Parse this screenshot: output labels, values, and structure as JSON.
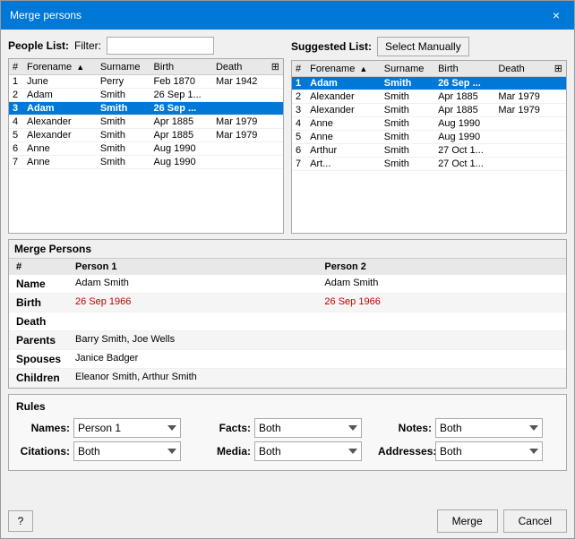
{
  "dialog": {
    "title": "Merge persons",
    "close_label": "×"
  },
  "people_list": {
    "label": "People List:",
    "filter_label": "Filter:",
    "filter_placeholder": "",
    "columns": [
      "#",
      "Forename",
      "Surname",
      "Birth",
      "Death"
    ],
    "rows": [
      {
        "forename": "June",
        "surname": "Perry",
        "birth": "Feb 1870",
        "death": "Mar 1942",
        "selected": false
      },
      {
        "forename": "Adam",
        "surname": "Smith",
        "birth": "26 Sep 1...",
        "death": "",
        "selected": false
      },
      {
        "forename": "Adam",
        "surname": "Smith",
        "birth": "26 Sep ...",
        "death": "",
        "selected": true
      },
      {
        "forename": "Alexander",
        "surname": "Smith",
        "birth": "Apr 1885",
        "death": "Mar 1979",
        "selected": false
      },
      {
        "forename": "Alexander",
        "surname": "Smith",
        "birth": "Apr 1885",
        "death": "Mar 1979",
        "selected": false
      },
      {
        "forename": "Anne",
        "surname": "Smith",
        "birth": "Aug 1990",
        "death": "",
        "selected": false
      },
      {
        "forename": "Anne",
        "surname": "Smith",
        "birth": "Aug 1990",
        "death": "",
        "selected": false
      }
    ]
  },
  "suggested_list": {
    "label": "Suggested List:",
    "select_manually_label": "Select Manually",
    "columns": [
      "#",
      "Forename",
      "Surname",
      "Birth",
      "Death"
    ],
    "rows": [
      {
        "forename": "Adam",
        "surname": "Smith",
        "birth": "26 Sep ...",
        "death": "",
        "selected": true
      },
      {
        "forename": "Alexander",
        "surname": "Smith",
        "birth": "Apr 1885",
        "death": "Mar 1979",
        "selected": false
      },
      {
        "forename": "Alexander",
        "surname": "Smith",
        "birth": "Apr 1885",
        "death": "Mar 1979",
        "selected": false
      },
      {
        "forename": "Anne",
        "surname": "Smith",
        "birth": "Aug 1990",
        "death": "",
        "selected": false
      },
      {
        "forename": "Anne",
        "surname": "Smith",
        "birth": "Aug 1990",
        "death": "",
        "selected": false
      },
      {
        "forename": "Arthur",
        "surname": "Smith",
        "birth": "27 Oct 1...",
        "death": "",
        "selected": false
      },
      {
        "forename": "Art...",
        "surname": "Smith",
        "birth": "27 Oct 1...",
        "death": "",
        "selected": false
      }
    ]
  },
  "merge_persons": {
    "section_title": "Merge Persons",
    "col_hash": "#",
    "col_person1": "Person 1",
    "col_person2": "Person 2",
    "fields": [
      {
        "label": "Name",
        "person1": "Adam Smith",
        "person2": "Adam Smith",
        "p1_highlight": false,
        "p2_highlight": false
      },
      {
        "label": "Birth",
        "person1": "26 Sep 1966",
        "person2": "26 Sep 1966",
        "p1_highlight": true,
        "p2_highlight": true
      },
      {
        "label": "Death",
        "person1": "",
        "person2": "",
        "p1_highlight": false,
        "p2_highlight": false
      },
      {
        "label": "Parents",
        "person1": "Barry Smith, Joe Wells",
        "person2": "",
        "p1_highlight": false,
        "p2_highlight": false
      },
      {
        "label": "Spouses",
        "person1": "Janice Badger",
        "person2": "",
        "p1_highlight": false,
        "p2_highlight": false
      },
      {
        "label": "Children",
        "person1": "Eleanor Smith, Arthur Smith",
        "person2": "",
        "p1_highlight": false,
        "p2_highlight": false
      }
    ]
  },
  "rules": {
    "section_title": "Rules",
    "fields": [
      {
        "label": "Names:",
        "value": "Person 1",
        "options": [
          "Person 1",
          "Person 2",
          "Both"
        ]
      },
      {
        "label": "Facts:",
        "value": "Both",
        "options": [
          "Person 1",
          "Person 2",
          "Both"
        ]
      },
      {
        "label": "Notes:",
        "value": "Both",
        "options": [
          "Person 1",
          "Person 2",
          "Both"
        ]
      },
      {
        "label": "Citations:",
        "value": "Both",
        "options": [
          "Person 1",
          "Person 2",
          "Both"
        ]
      },
      {
        "label": "Media:",
        "value": "Both",
        "options": [
          "Person 1",
          "Person 2",
          "Both"
        ]
      },
      {
        "label": "Addresses:",
        "value": "Both",
        "options": [
          "Person 1",
          "Person 2",
          "Both"
        ]
      }
    ]
  },
  "buttons": {
    "help_label": "?",
    "merge_label": "Merge",
    "cancel_label": "Cancel"
  }
}
